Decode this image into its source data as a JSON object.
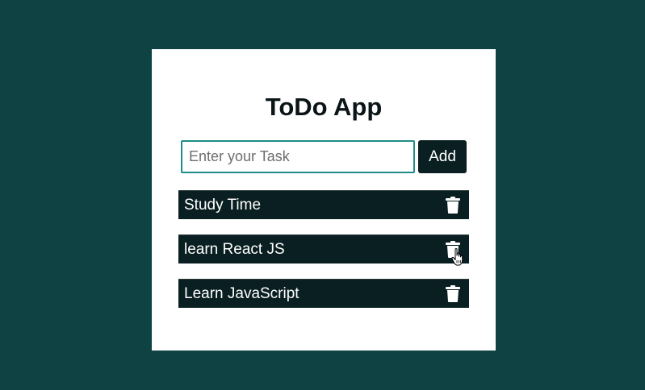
{
  "app": {
    "title": "ToDo App"
  },
  "input": {
    "placeholder": "Enter your Task",
    "value": ""
  },
  "add_button": {
    "label": "Add"
  },
  "tasks": [
    {
      "text": "Study Time",
      "action_icon": "trash-icon"
    },
    {
      "text": "learn React JS",
      "action_icon": "trash-icon"
    },
    {
      "text": "Learn JavaScript",
      "action_icon": "trash-icon"
    }
  ],
  "colors": {
    "page_background": "#0e4243",
    "card_background": "#ffffff",
    "task_background": "#0a1f21",
    "input_border": "#1e8c88",
    "button_background": "#0a1f21",
    "text_light": "#ffffff"
  },
  "cursor": {
    "type": "hand-pointer",
    "over": "tasks.1.delete"
  }
}
